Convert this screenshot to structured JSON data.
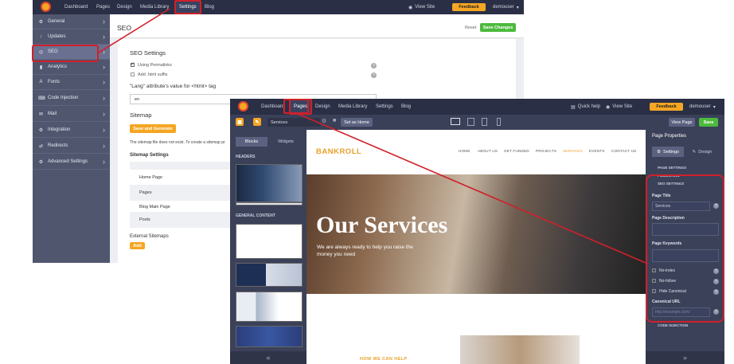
{
  "back": {
    "nav": [
      "Dashboard",
      "Pages",
      "Design",
      "Media Library",
      "Settings",
      "Blog"
    ],
    "active_nav": "Settings",
    "view_site": "View Site",
    "feedback": "Feedback",
    "user": "demouser",
    "sidebar": [
      {
        "icon": "⚙",
        "label": "General"
      },
      {
        "icon": "↓",
        "label": "Updates"
      },
      {
        "icon": "◎",
        "label": "SEO"
      },
      {
        "icon": "▮",
        "label": "Analytics"
      },
      {
        "icon": "A",
        "label": "Fonts"
      },
      {
        "icon": "⌨",
        "label": "Code Injection"
      },
      {
        "icon": "✉",
        "label": "Mail"
      },
      {
        "icon": "⚙",
        "label": "Integration"
      },
      {
        "icon": "⇄",
        "label": "Redirects"
      },
      {
        "icon": "⚙",
        "label": "Advanced Settings"
      }
    ],
    "page_title": "SEO",
    "reset": "Reset",
    "save_changes": "Save Changes",
    "section_title": "SEO Settings",
    "use_permalinks": "Using Permalinks",
    "add_html_suffix": "Add .html suffix",
    "lang_label": "\"Lang\" attribute's value for <html> tag",
    "lang_value": "en",
    "sitemap_title": "Sitemap",
    "save_generate": "Save and Generate",
    "sitemap_note": "The sitemap file does not exist. To create a sitemap pr",
    "sitemap_settings": "Sitemap Settings",
    "sitemap_rows": [
      "Home Page",
      "Pages",
      "Blog Main Page",
      "Posts"
    ],
    "external_sitemaps": "External Sitemaps",
    "add": "Add"
  },
  "front": {
    "nav": [
      "Dashboard",
      "Pages",
      "Design",
      "Media Library",
      "Settings",
      "Blog"
    ],
    "active_nav": "Pages",
    "quick_help": "Quick help",
    "view_site": "View Site",
    "feedback": "Feedback",
    "user": "demouser",
    "page_select": "Services",
    "set_home": "Set as Home",
    "view_page": "View Page",
    "save": "Save",
    "tab_blocks": "Blocks",
    "tab_widgets": "Widgets",
    "group_headers": "HEADERS",
    "group_general": "GENERAL CONTENT",
    "brand": "BANKROLL",
    "site_menu": [
      "HOME",
      "ABOUT US",
      "GET FUNDED",
      "PROJECTS",
      "SERVICES",
      "EVENTS",
      "CONTACT US"
    ],
    "active_menu": "SERVICES",
    "hero_title": "Our Services",
    "hero_sub1": "We are always ready to help you raise the",
    "hero_sub2": "money you need",
    "how_we_help": "HOW WE CAN HELP",
    "props_title": "Page Properties",
    "tab_settings": "Settings",
    "tab_design": "Design",
    "sec_page_settings": "PAGE SETTINGS",
    "sec_publishing": "PUBLISHING",
    "sec_seo": "SEO SETTINGS",
    "page_title_label": "Page Title",
    "page_title_value": "Services",
    "page_desc_label": "Page Description",
    "page_keywords_label": "Page Keywords",
    "no_index": "No-index",
    "no_follow": "No-follow",
    "hide_canonical": "Hide Canonical",
    "canonical_label": "Canonical URL",
    "canonical_placeholder": "http://example.com/",
    "code_injection": "CODE INJECTION"
  },
  "colors": {
    "accent": "#f5a623",
    "highlight": "#d0202a",
    "dark": "#2a2f45",
    "green": "#4cba3c"
  }
}
